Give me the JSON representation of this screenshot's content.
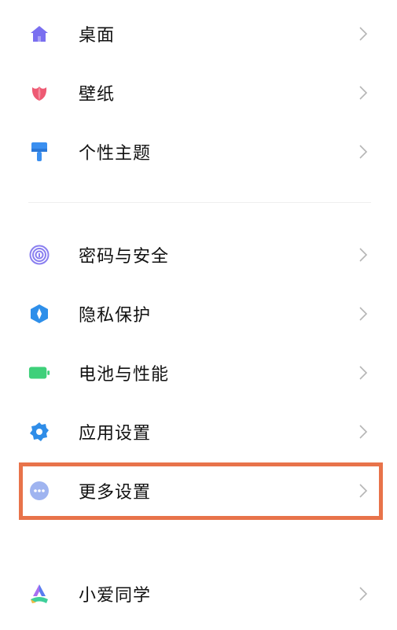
{
  "items": [
    {
      "label": "桌面",
      "icon": "home-icon"
    },
    {
      "label": "壁纸",
      "icon": "tulip-icon"
    },
    {
      "label": "个性主题",
      "icon": "brush-icon"
    },
    {
      "label": "密码与安全",
      "icon": "fingerprint-icon"
    },
    {
      "label": "隐私保护",
      "icon": "privacy-shield-icon"
    },
    {
      "label": "电池与性能",
      "icon": "battery-icon"
    },
    {
      "label": "应用设置",
      "icon": "gear-icon"
    },
    {
      "label": "更多设置",
      "icon": "more-dots-icon"
    },
    {
      "label": "小爱同学",
      "icon": "xiaoai-icon"
    }
  ],
  "colors": {
    "home": "#7a6ff0",
    "tulip": "#ee5a73",
    "brush": "#3a8ff0",
    "fingerprint": "#8a7ff0",
    "privacy": "#2e8fea",
    "battery": "#3ed07a",
    "gear": "#2f8de8",
    "more": "#9fb4f0",
    "highlight": "#e8734a"
  }
}
